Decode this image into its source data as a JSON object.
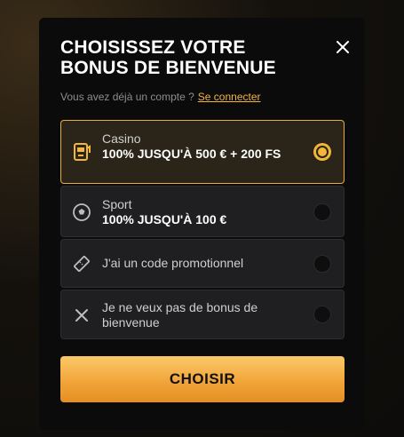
{
  "modal": {
    "title": "CHOISISSEZ VOTRE BONUS DE BIENVENUE",
    "login_prompt": "Vous avez déjà un compte ?",
    "login_link": "Se connecter",
    "close_icon": "close-icon"
  },
  "options": [
    {
      "label": "Casino",
      "value": "100% JUSQU'À 500 € + 200 FS",
      "icon": "slot-machine-icon",
      "selected": true
    },
    {
      "label": "Sport",
      "value": "100% JUSQU'À 100 €",
      "icon": "soccer-ball-icon",
      "selected": false
    },
    {
      "label": "J'ai un code promotionnel",
      "icon": "ticket-icon",
      "selected": false
    },
    {
      "label": "Je ne veux pas de bonus de bienvenue",
      "icon": "close-icon",
      "selected": false
    }
  ],
  "cta": {
    "label": "CHOISIR"
  },
  "colors": {
    "accent": "#f2b53d",
    "background": "#0b0b0c",
    "card": "#1f1f21"
  }
}
